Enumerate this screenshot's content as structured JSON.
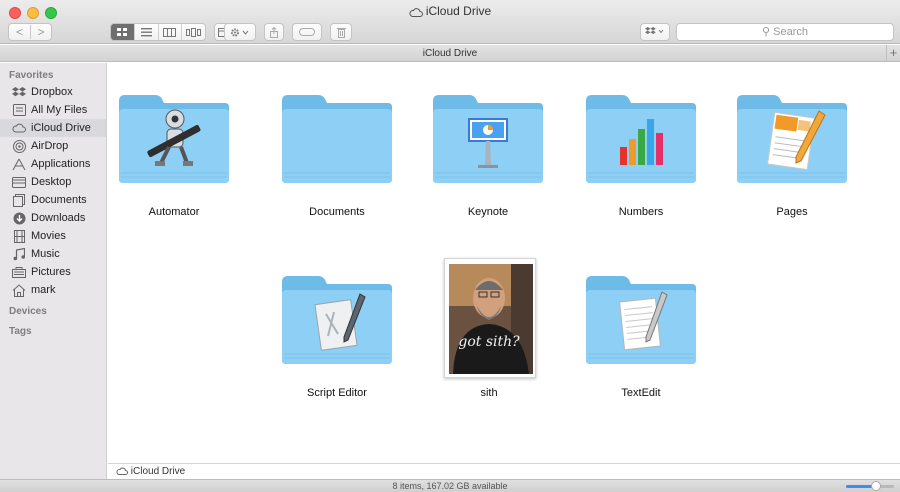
{
  "window": {
    "title": "iCloud Drive"
  },
  "toolbar": {
    "back_label": "<",
    "forward_label": ">",
    "search_placeholder": "Search",
    "icons": [
      "icon-view-icon",
      "list-view-icon",
      "column-view-icon",
      "cover-flow-icon",
      "arrange-icon",
      "action-gear-icon",
      "share-icon",
      "tag-icon",
      "trash-icon",
      "dropbox-icon"
    ]
  },
  "pathbar": {
    "title": "iCloud Drive"
  },
  "sidebar": {
    "favorites_header": "Favorites",
    "items": [
      {
        "label": "Dropbox",
        "icon": "dropbox-icon"
      },
      {
        "label": "All My Files",
        "icon": "all-files-icon"
      },
      {
        "label": "iCloud Drive",
        "icon": "cloud-icon",
        "active": true
      },
      {
        "label": "AirDrop",
        "icon": "airdrop-icon"
      },
      {
        "label": "Applications",
        "icon": "applications-icon"
      },
      {
        "label": "Desktop",
        "icon": "desktop-icon"
      },
      {
        "label": "Documents",
        "icon": "documents-icon"
      },
      {
        "label": "Downloads",
        "icon": "downloads-icon"
      },
      {
        "label": "Movies",
        "icon": "movies-icon"
      },
      {
        "label": "Music",
        "icon": "music-icon"
      },
      {
        "label": "Pictures",
        "icon": "pictures-icon"
      },
      {
        "label": "mark",
        "icon": "home-icon"
      }
    ],
    "devices_header": "Devices",
    "tags_header": "Tags"
  },
  "files": [
    {
      "name": "Automator",
      "kind": "folder",
      "badge": "automator-robot-icon"
    },
    {
      "name": "Documents",
      "kind": "folder",
      "badge": ""
    },
    {
      "name": "Keynote",
      "kind": "folder",
      "badge": "keynote-podium-icon"
    },
    {
      "name": "Numbers",
      "kind": "folder",
      "badge": "numbers-chart-icon"
    },
    {
      "name": "Pages",
      "kind": "folder",
      "badge": "pages-document-icon"
    },
    {
      "name": "Script Editor",
      "kind": "folder",
      "badge": "script-editor-icon"
    },
    {
      "name": "sith",
      "kind": "image",
      "photo_text": "got sith?"
    },
    {
      "name": "TextEdit",
      "kind": "folder",
      "badge": "textedit-page-icon"
    }
  ],
  "bottom_path": "iCloud Drive",
  "status": {
    "text": "8 items, 167.02 GB available",
    "zoom_level": 0.62
  },
  "colors": {
    "folder": "#8ecff5",
    "folder_dark": "#6fbbe8",
    "accent": "#3b8df5"
  }
}
